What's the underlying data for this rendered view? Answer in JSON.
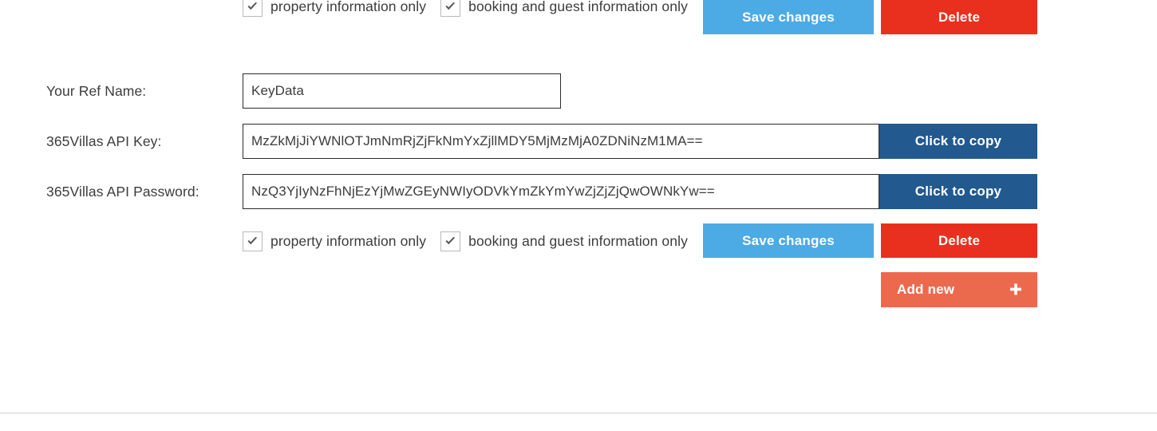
{
  "permissions_top": {
    "checkbox_property": {
      "label": "property information only",
      "checked": true,
      "icon": "check-icon"
    },
    "checkbox_booking": {
      "label": "booking and guest information only",
      "checked": true,
      "icon": "check-icon"
    },
    "save_label": "Save changes",
    "delete_label": "Delete"
  },
  "fields": [
    {
      "label": "Your Ref Name:",
      "value": "KeyData",
      "placeholder": "",
      "has_copy": false,
      "copy_label": ""
    },
    {
      "label": "365Villas API Key:",
      "value": "MzZkMjJiYWNlOTJmNmRjZjFkNmYxZjllMDY5MjMzMjA0ZDNiNzM1MA==",
      "placeholder": "",
      "has_copy": true,
      "copy_label": "Click to copy"
    },
    {
      "label": "365Villas API Password:",
      "value": "NzQ3YjIyNzFhNjEzYjMwZGEyNWIyODVkYmZkYmYwZjZjZjQwOWNkYw==",
      "placeholder": "",
      "has_copy": true,
      "copy_label": "Click to copy"
    }
  ],
  "permissions_bottom": {
    "checkbox_property": {
      "label": "property information only",
      "checked": true,
      "icon": "check-icon"
    },
    "checkbox_booking": {
      "label": "booking and guest information only",
      "checked": true,
      "icon": "check-icon"
    },
    "save_label": "Save changes",
    "delete_label": "Delete"
  },
  "add_new": {
    "label": "Add new",
    "icon": "plus-icon"
  },
  "colors": {
    "save_blue": "#4caae4",
    "delete_red": "#e9301e",
    "copy_blue": "#22598f",
    "add_salmon": "#eb6a4e",
    "text": "#3c3c3c",
    "input_border": "#2b2b2b",
    "checkbox_border": "#b9b9b9",
    "divider": "#cfcfcf"
  }
}
